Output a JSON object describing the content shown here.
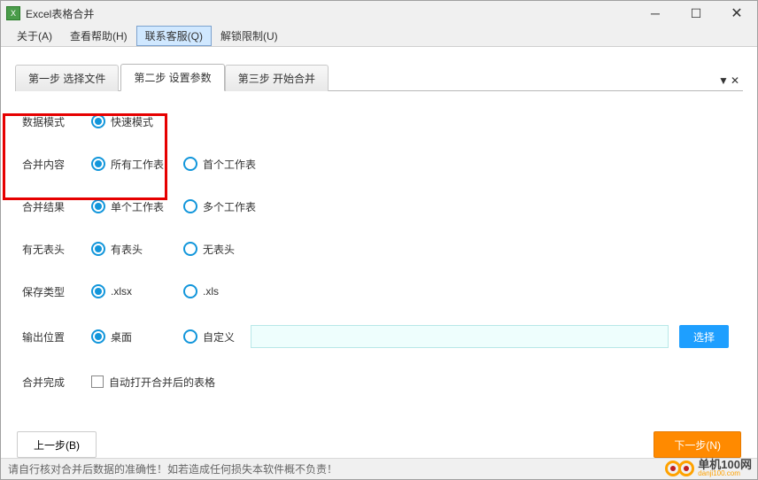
{
  "window": {
    "title": "Excel表格合并"
  },
  "menu": {
    "about": "关于(A)",
    "help": "查看帮助(H)",
    "contact": "联系客服(Q)",
    "unlock": "解锁限制(U)"
  },
  "tabs": {
    "step1": "第一步 选择文件",
    "step2": "第二步 设置参数",
    "step3": "第三步 开始合并"
  },
  "labels": {
    "dataMode": "数据模式",
    "mergeContent": "合并内容",
    "mergeResult": "合并结果",
    "hasHeader": "有无表头",
    "saveType": "保存类型",
    "outputPath": "输出位置",
    "mergeDone": "合并完成"
  },
  "options": {
    "dataMode1": "快速模式",
    "content1": "所有工作表",
    "content2": "首个工作表",
    "result1": "单个工作表",
    "result2": "多个工作表",
    "header1": "有表头",
    "header2": "无表头",
    "save1": ".xlsx",
    "save2": ".xls",
    "out1": "桌面",
    "out2": "自定义",
    "autoOpen": "自动打开合并后的表格"
  },
  "buttons": {
    "select": "选择",
    "prev": "上一步(B)",
    "next": "下一步(N)"
  },
  "status": "请自行核对合并后数据的准确性！如若造成任何损失本软件概不负责！",
  "watermark": {
    "cn": "单机100网",
    "en": "danji100.com"
  }
}
